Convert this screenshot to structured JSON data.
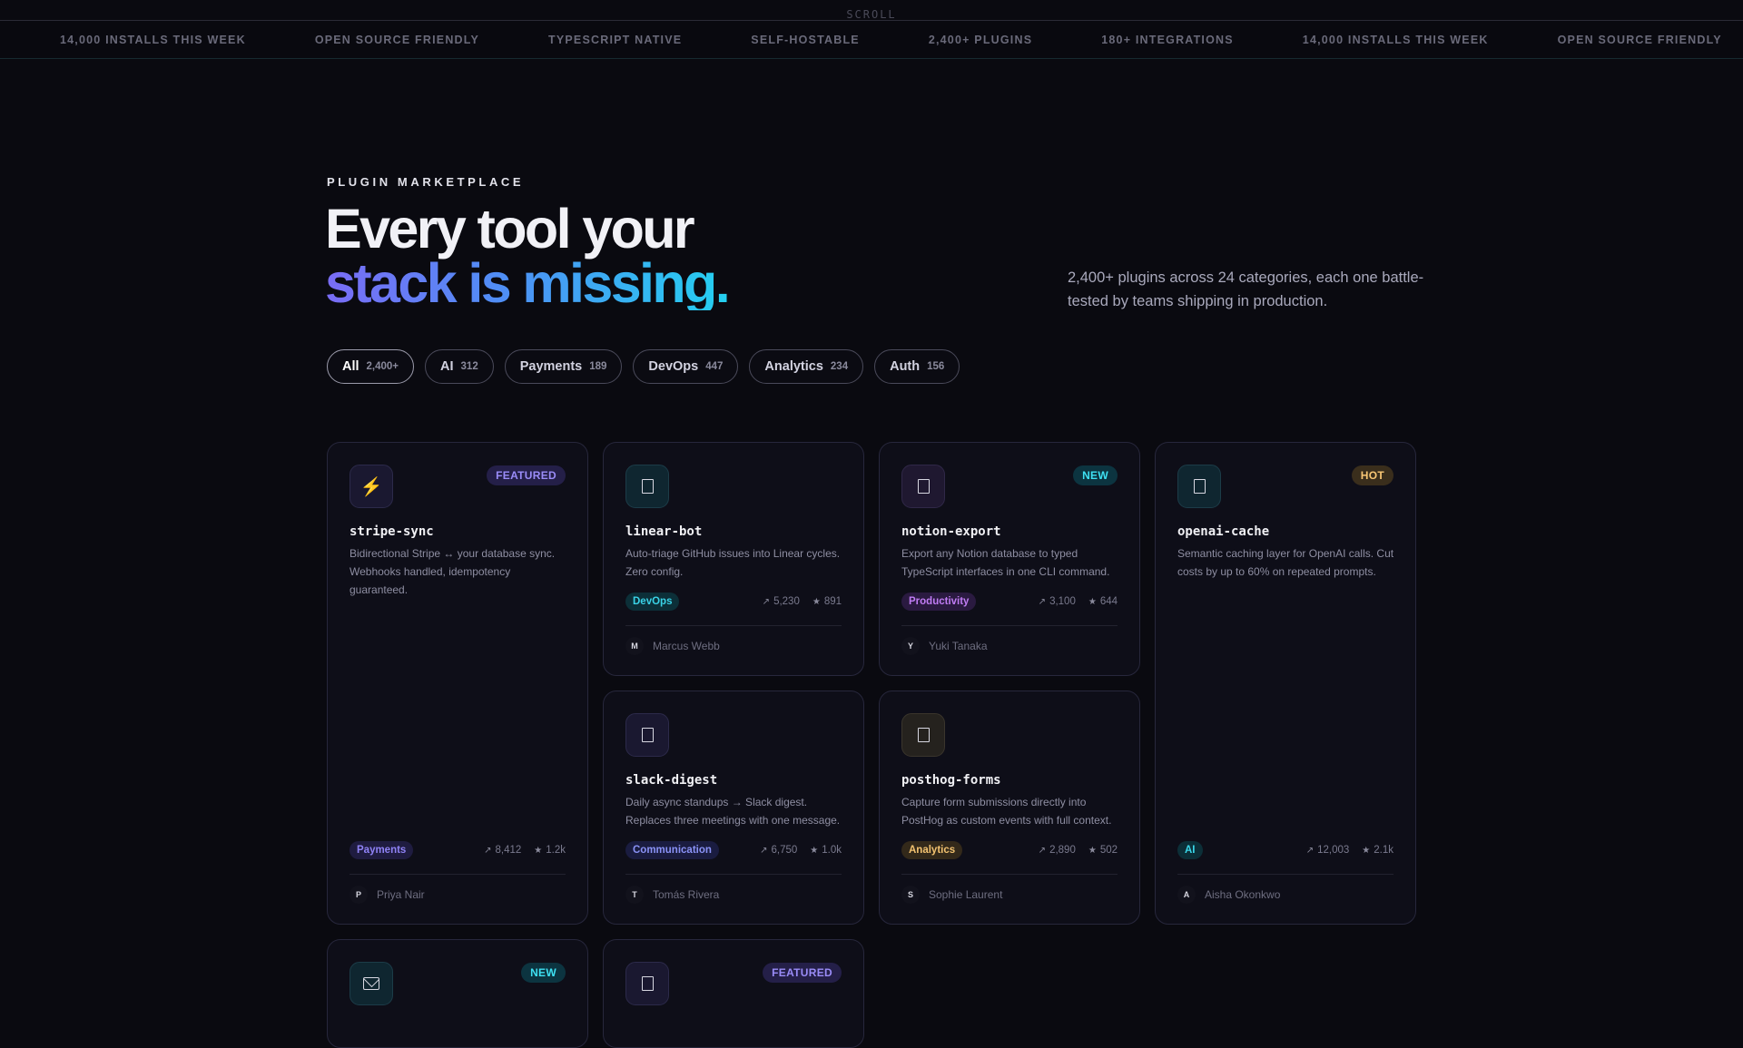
{
  "scroll_label": "SCROLL",
  "ticker": [
    "14,000 INSTALLS THIS WEEK",
    "OPEN SOURCE FRIENDLY",
    "TYPESCRIPT NATIVE",
    "SELF-HOSTABLE",
    "2,400+ PLUGINS",
    "180+ INTEGRATIONS",
    "14,000 INSTALLS THIS WEEK",
    "OPEN SOURCE FRIENDLY"
  ],
  "hero": {
    "eyebrow": "PLUGIN MARKETPLACE",
    "headline_1": "Every tool your",
    "headline_2": "stack is missing.",
    "description": "2,400+ plugins across 24 categories, each one battle-tested by teams shipping in production."
  },
  "filters": [
    {
      "label": "All",
      "count": "2,400+",
      "active": true
    },
    {
      "label": "AI",
      "count": "312"
    },
    {
      "label": "Payments",
      "count": "189"
    },
    {
      "label": "DevOps",
      "count": "447"
    },
    {
      "label": "Analytics",
      "count": "234"
    },
    {
      "label": "Auth",
      "count": "156"
    }
  ],
  "cards": [
    {
      "id": "stripe-sync",
      "name": "stripe-sync",
      "badge": "FEATURED",
      "icon": "lightning-icon",
      "description": "Bidirectional Stripe ↔ your database sync. Webhooks handled, idempotency guaranteed.",
      "tag": "Payments",
      "installs": "8,412",
      "stars": "1.2k",
      "author_initial": "P",
      "author": "Priya Nair"
    },
    {
      "id": "linear-bot",
      "name": "linear-bot",
      "badge": "",
      "icon": "box-icon",
      "description": "Auto-triage GitHub issues into Linear cycles. Zero config.",
      "tag": "DevOps",
      "installs": "5,230",
      "stars": "891",
      "author_initial": "M",
      "author": "Marcus Webb"
    },
    {
      "id": "notion-export",
      "name": "notion-export",
      "badge": "NEW",
      "icon": "box-icon",
      "description": "Export any Notion database to typed TypeScript interfaces in one CLI command.",
      "tag": "Productivity",
      "installs": "3,100",
      "stars": "644",
      "author_initial": "Y",
      "author": "Yuki Tanaka"
    },
    {
      "id": "openai-cache",
      "name": "openai-cache",
      "badge": "HOT",
      "icon": "box-icon",
      "description": "Semantic caching layer for OpenAI calls. Cut costs by up to 60% on repeated prompts.",
      "tag": "AI",
      "installs": "12,003",
      "stars": "2.1k",
      "author_initial": "A",
      "author": "Aisha Okonkwo"
    },
    {
      "id": "slack-digest",
      "name": "slack-digest",
      "badge": "",
      "icon": "box-icon",
      "description": "Daily async standups → Slack digest. Replaces three meetings with one message.",
      "tag": "Communication",
      "installs": "6,750",
      "stars": "1.0k",
      "author_initial": "T",
      "author": "Tomás Rivera"
    },
    {
      "id": "posthog-forms",
      "name": "posthog-forms",
      "badge": "",
      "icon": "box-icon",
      "description": "Capture form submissions directly into PostHog as custom events with full context.",
      "tag": "Analytics",
      "installs": "2,890",
      "stars": "502",
      "author_initial": "S",
      "author": "Sophie Laurent"
    },
    {
      "id": "card-7",
      "badge": "NEW",
      "icon": "envelope-icon"
    },
    {
      "id": "card-8",
      "badge": "FEATURED",
      "icon": "box-icon"
    }
  ],
  "colors": {
    "background": "#0a0a10",
    "accent_violet": "#7a6cf5",
    "accent_cyan": "#24d0f0"
  }
}
